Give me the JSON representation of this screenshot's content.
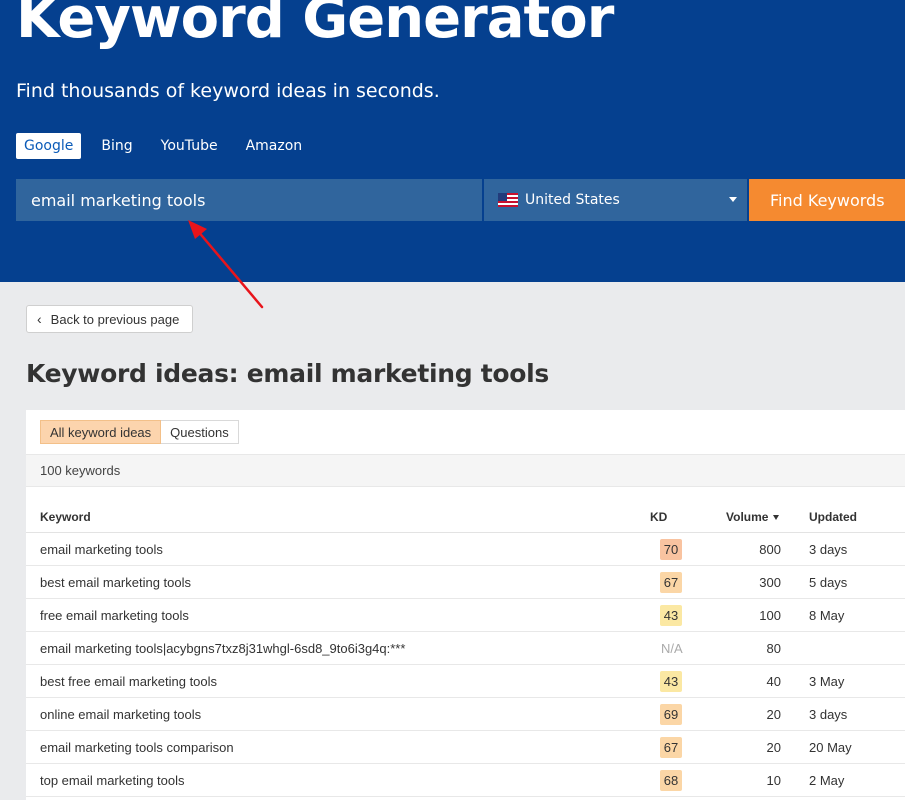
{
  "hero": {
    "title": "Keyword Generator",
    "subtitle": "Find thousands of keyword ideas in seconds.",
    "engines": [
      {
        "label": "Google",
        "active": true
      },
      {
        "label": "Bing",
        "active": false
      },
      {
        "label": "YouTube",
        "active": false
      },
      {
        "label": "Amazon",
        "active": false
      }
    ],
    "search_value": "email marketing tools",
    "country": "United States",
    "find_label": "Find Keywords"
  },
  "back_label": "Back to previous page",
  "page_title": "Keyword ideas: email marketing tools",
  "tabs": [
    {
      "label": "All keyword ideas",
      "active": true
    },
    {
      "label": "Questions",
      "active": false
    }
  ],
  "count_text": "100 keywords",
  "table": {
    "headers": {
      "keyword": "Keyword",
      "kd": "KD",
      "volume": "Volume",
      "updated": "Updated"
    },
    "rows": [
      {
        "keyword": "email marketing tools",
        "kd": "70",
        "kd_color": "#f9c3a0",
        "volume": "800",
        "updated": "3 days"
      },
      {
        "keyword": "best email marketing tools",
        "kd": "67",
        "kd_color": "#fbd6a6",
        "volume": "300",
        "updated": "5 days"
      },
      {
        "keyword": "free email marketing tools",
        "kd": "43",
        "kd_color": "#fbe8a3",
        "volume": "100",
        "updated": "8 May"
      },
      {
        "keyword": "email marketing tools|acybgns7txz8j31whgl-6sd8_9to6i3g4q:***",
        "kd": "N/A",
        "kd_color": "",
        "volume": "80",
        "updated": ""
      },
      {
        "keyword": "best free email marketing tools",
        "kd": "43",
        "kd_color": "#fbe8a3",
        "volume": "40",
        "updated": "3 May"
      },
      {
        "keyword": "online email marketing tools",
        "kd": "69",
        "kd_color": "#fbd6a6",
        "volume": "20",
        "updated": "3 days"
      },
      {
        "keyword": "email marketing tools comparison",
        "kd": "67",
        "kd_color": "#fbd6a6",
        "volume": "20",
        "updated": "20 May"
      },
      {
        "keyword": "top email marketing tools",
        "kd": "68",
        "kd_color": "#fbd6a6",
        "volume": "10",
        "updated": "2 May"
      }
    ]
  },
  "colors": {
    "hero_bg": "#05408f",
    "input_bg": "#30659d",
    "accent": "#f58a30",
    "annotation_arrow": "#e8141b"
  }
}
